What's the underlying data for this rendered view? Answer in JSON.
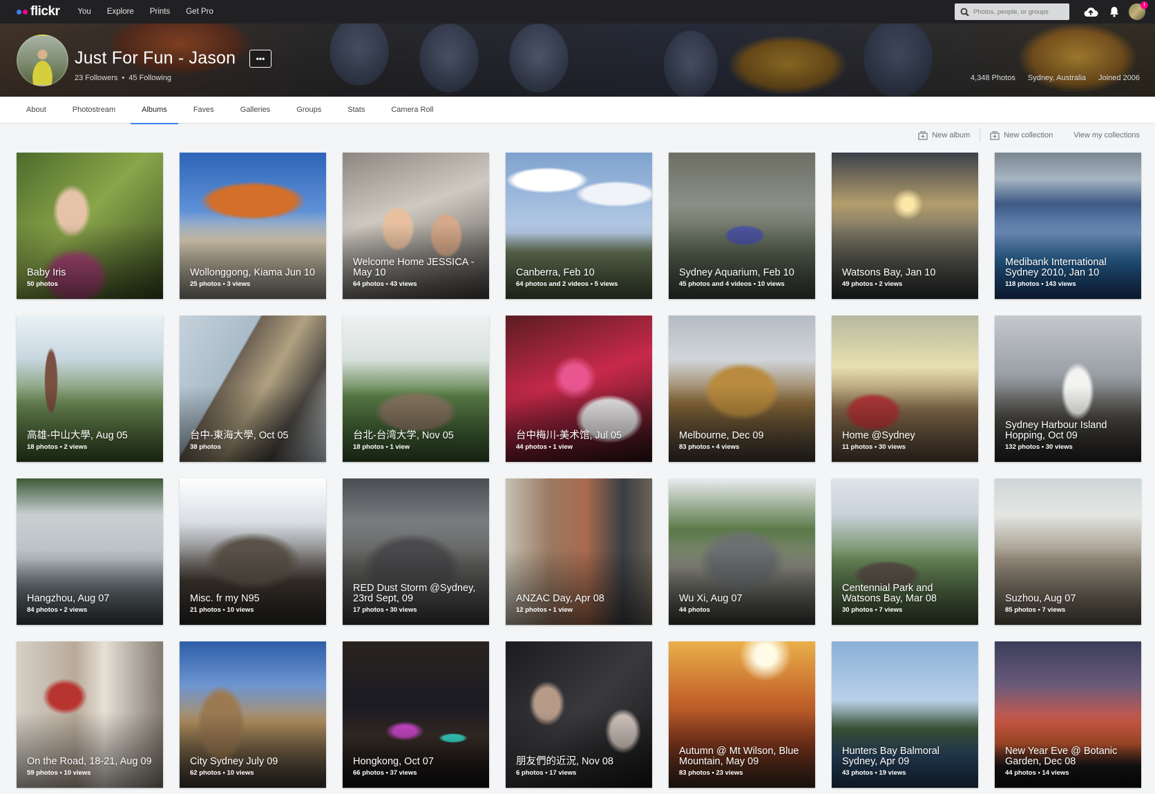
{
  "nav": {
    "logo": "flickr",
    "links": [
      "You",
      "Explore",
      "Prints",
      "Get Pro"
    ],
    "search_placeholder": "Photos, people, or groups",
    "notif_badge": "!"
  },
  "profile": {
    "name": "Just For Fun - Jason",
    "more": "•••",
    "followers": "23 Followers",
    "following": "45 Following",
    "photos": "4,348 Photos",
    "location": "Sydney, Australia",
    "joined": "Joined 2006"
  },
  "tabs": [
    "About",
    "Photostream",
    "Albums",
    "Faves",
    "Galleries",
    "Groups",
    "Stats",
    "Camera Roll"
  ],
  "active_tab": "Albums",
  "actions": {
    "new_album": "New album",
    "new_collection": "New collection",
    "view_collections": "View my collections"
  },
  "albums": [
    {
      "title": "Baby Iris",
      "count": "50 photos"
    },
    {
      "title": "Wollonggong, Kiama Jun 10",
      "count": "25 photos  •  3 views"
    },
    {
      "title": "Welcome Home JESSICA - May 10",
      "count": "64 photos  •  43 views"
    },
    {
      "title": "Canberra, Feb 10",
      "count": "64 photos and 2 videos  •  5 views"
    },
    {
      "title": "Sydney Aquarium, Feb 10",
      "count": "45 photos and 4 videos  •  10 views"
    },
    {
      "title": "Watsons Bay, Jan 10",
      "count": "49 photos  •  2 views"
    },
    {
      "title": "Medibank International Sydney 2010, Jan 10",
      "count": "118 photos  •  143 views"
    },
    {
      "title": "高雄-中山大學, Aug 05",
      "count": "18 photos  •  2 views"
    },
    {
      "title": "台中-東海大學, Oct 05",
      "count": "38 photos"
    },
    {
      "title": "台北-台湾大学, Nov 05",
      "count": "18 photos  •  1 view"
    },
    {
      "title": "台中梅川-美术馆, Jul 05",
      "count": "44 photos  •  1 view"
    },
    {
      "title": "Melbourne, Dec 09",
      "count": "83 photos  •  4 views"
    },
    {
      "title": "Home @Sydney",
      "count": "11 photos  •  30 views"
    },
    {
      "title": "Sydney Harbour Island Hopping, Oct 09",
      "count": "132 photos  •  30 views"
    },
    {
      "title": "Hangzhou, Aug 07",
      "count": "84 photos  •  2 views"
    },
    {
      "title": "Misc. fr my N95",
      "count": "21 photos  •  10 views"
    },
    {
      "title": "RED Dust Storm @Sydney, 23rd Sept, 09",
      "count": "17 photos  •  30 views"
    },
    {
      "title": "ANZAC Day, Apr 08",
      "count": "12 photos  •  1 view"
    },
    {
      "title": "Wu Xi, Aug 07",
      "count": "44 photos"
    },
    {
      "title": "Centennial Park and Watsons Bay, Mar 08",
      "count": "30 photos  •  7 views"
    },
    {
      "title": "Suzhou, Aug 07",
      "count": "85 photos  •  7 views"
    },
    {
      "title": "On the Road, 18-21, Aug 09",
      "count": "59 photos  •  10 views"
    },
    {
      "title": "City Sydney July 09",
      "count": "62 photos  •  10 views"
    },
    {
      "title": "Hongkong, Oct 07",
      "count": "66 photos  •  37 views"
    },
    {
      "title": "朋友們的近況, Nov 08",
      "count": "6 photos  •  17 views"
    },
    {
      "title": "Autumn @ Mt Wilson, Blue Mountain, May 09",
      "count": "83 photos  •  23 views"
    },
    {
      "title": "Hunters Bay Balmoral Sydney, Apr 09",
      "count": "43 photos  •  19 views"
    },
    {
      "title": "New Year Eve @ Botanic Garden, Dec 08",
      "count": "44 photos  •  14 views"
    }
  ]
}
